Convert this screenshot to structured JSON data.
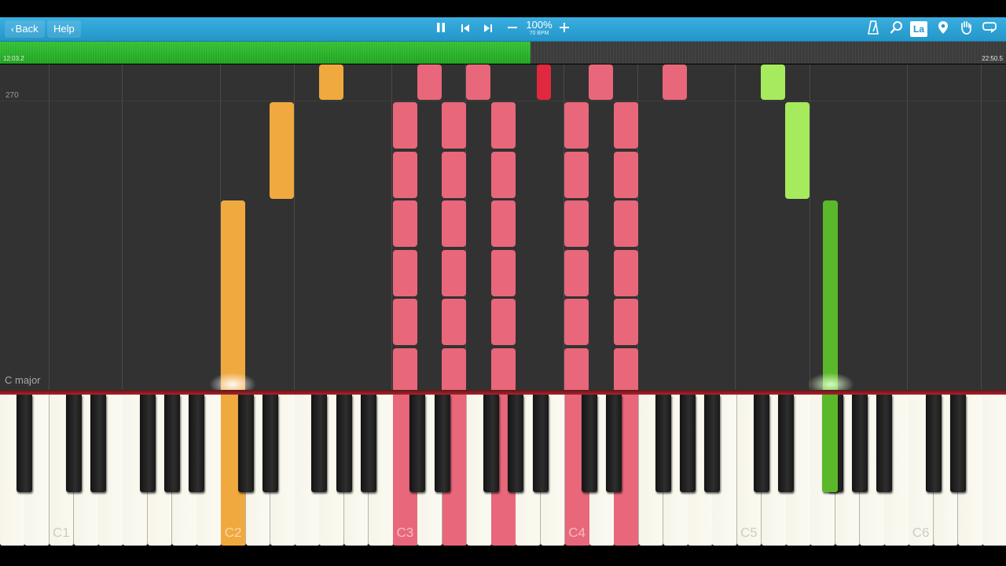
{
  "toolbar": {
    "back_label": "Back",
    "help_label": "Help",
    "zoom_percent": "100%",
    "tempo": "70 BPM",
    "icons": [
      "pause-icon",
      "skip-back-icon",
      "skip-forward-icon",
      "minus-icon",
      "plus-icon",
      "metronome-icon",
      "search-icon",
      "la-label-icon",
      "location-pin-icon",
      "hand-icon",
      "loop-icon"
    ],
    "la_label": "La"
  },
  "progress": {
    "elapsed": "12:03.2",
    "total": "22:50.5",
    "fraction": 0.527,
    "color": "#2db82d"
  },
  "roll": {
    "measure_number": "270",
    "key_signature": "C major",
    "colors": {
      "left_hand_orange": "#f0a93e",
      "right_hand_pink": "#e8677a",
      "accent_red": "#e0293f",
      "light_green": "#a6ea5e",
      "green": "#5bb82a"
    }
  },
  "keyboard": {
    "octave_labels": [
      "C1",
      "C2",
      "C3",
      "C4",
      "C5",
      "C6"
    ],
    "pressed_color_left": "#f0a93e",
    "pressed_color_right": "#e8677a",
    "pressed_color_green": "#5bb82a"
  }
}
